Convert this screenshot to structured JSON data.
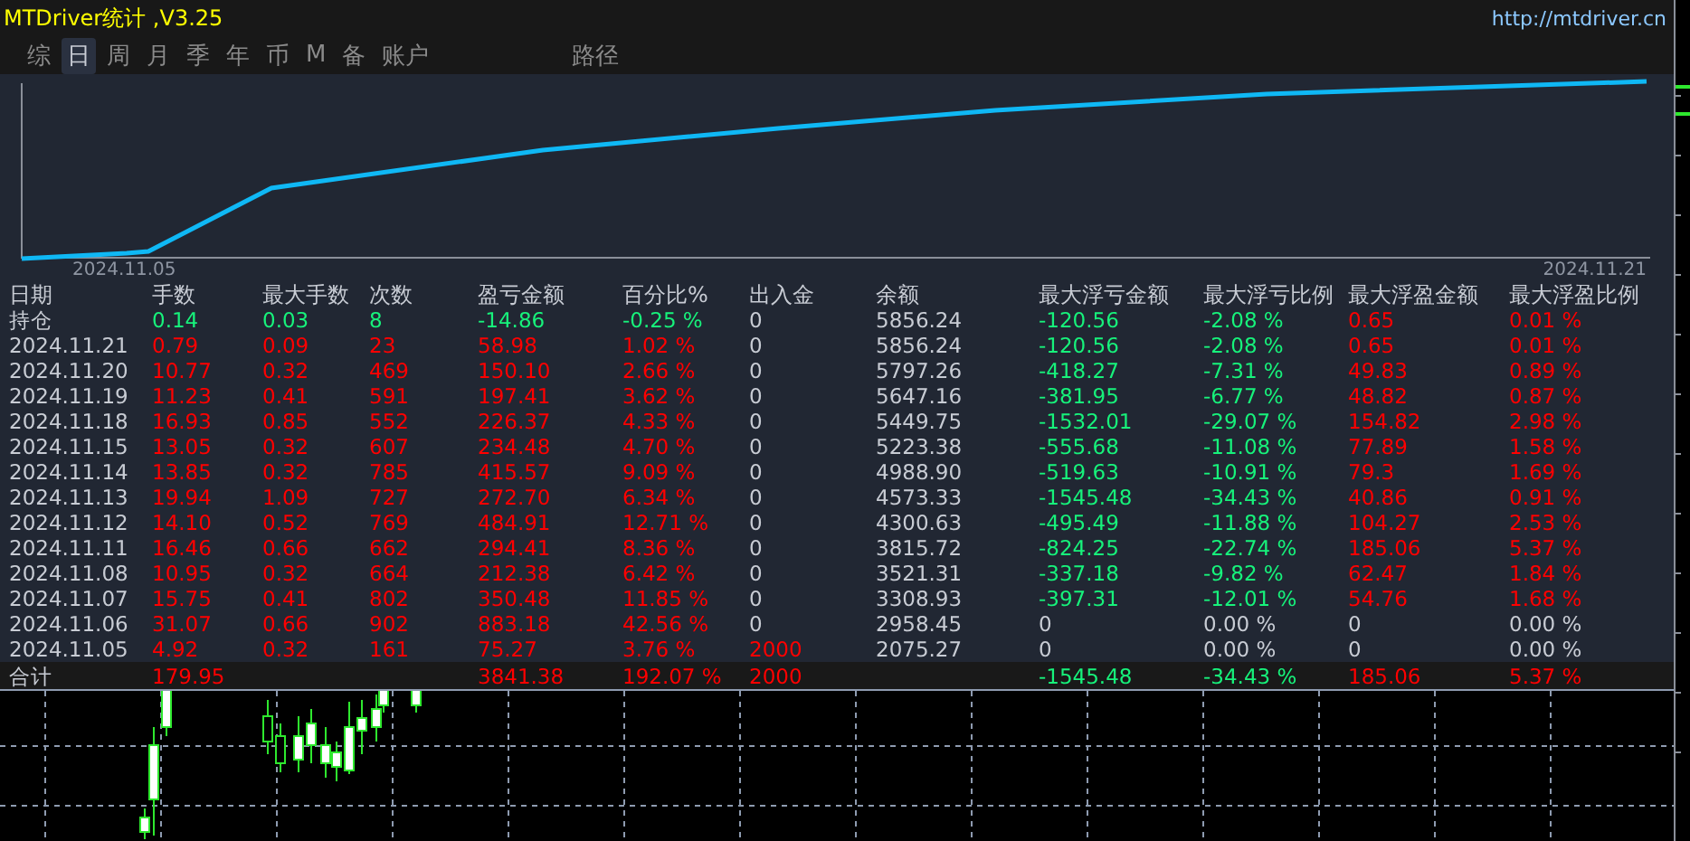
{
  "window": {
    "title": "MTDriver统计 ,V3.25",
    "link": "http://mtdriver.cn"
  },
  "tabs": [
    {
      "label": "综",
      "selected": false
    },
    {
      "label": "日",
      "selected": true
    },
    {
      "label": "周",
      "selected": false
    },
    {
      "label": "月",
      "selected": false
    },
    {
      "label": "季",
      "selected": false
    },
    {
      "label": "年",
      "selected": false
    },
    {
      "label": "币",
      "selected": false
    },
    {
      "label": "M",
      "selected": false
    },
    {
      "label": "备",
      "selected": false
    },
    {
      "label": "账户",
      "selected": false
    }
  ],
  "path_tab": {
    "label": "路径",
    "selected": false
  },
  "equity_chart": {
    "start_label": "2024.11.05",
    "end_label": "2024.11.21"
  },
  "table": {
    "columns": [
      "日期",
      "手数",
      "最大手数",
      "次数",
      "盈亏金额",
      "百分比%",
      "出入金",
      "余额",
      "最大浮亏金额",
      "最大浮亏比例",
      "最大浮盈金额",
      "最大浮盈比例"
    ],
    "rows": [
      {
        "cells": [
          {
            "text": "持仓",
            "color": "#c8ccd4"
          },
          {
            "text": "0.14",
            "color": "#17f27b"
          },
          {
            "text": "0.03",
            "color": "#17f27b"
          },
          {
            "text": "8",
            "color": "#17f27b"
          },
          {
            "text": "-14.86",
            "color": "#17f27b"
          },
          {
            "text": "-0.25 %",
            "color": "#17f27b"
          },
          {
            "text": "0",
            "color": "#c8ccd4"
          },
          {
            "text": "5856.24",
            "color": "#c8ccd4"
          },
          {
            "text": "-120.56",
            "color": "#17f27b"
          },
          {
            "text": "-2.08 %",
            "color": "#17f27b"
          },
          {
            "text": "0.65",
            "color": "#ff0000"
          },
          {
            "text": "0.01 %",
            "color": "#ff0000"
          }
        ]
      },
      {
        "cells": [
          {
            "text": "2024.11.21",
            "color": "#c8ccd4"
          },
          {
            "text": "0.79",
            "color": "#ff0000"
          },
          {
            "text": "0.09",
            "color": "#ff0000"
          },
          {
            "text": "23",
            "color": "#ff0000"
          },
          {
            "text": "58.98",
            "color": "#ff0000"
          },
          {
            "text": "1.02 %",
            "color": "#ff0000"
          },
          {
            "text": "0",
            "color": "#c8ccd4"
          },
          {
            "text": "5856.24",
            "color": "#c8ccd4"
          },
          {
            "text": "-120.56",
            "color": "#17f27b"
          },
          {
            "text": "-2.08 %",
            "color": "#17f27b"
          },
          {
            "text": "0.65",
            "color": "#ff0000"
          },
          {
            "text": "0.01 %",
            "color": "#ff0000"
          }
        ]
      },
      {
        "cells": [
          {
            "text": "2024.11.20",
            "color": "#c8ccd4"
          },
          {
            "text": "10.77",
            "color": "#ff0000"
          },
          {
            "text": "0.32",
            "color": "#ff0000"
          },
          {
            "text": "469",
            "color": "#ff0000"
          },
          {
            "text": "150.10",
            "color": "#ff0000"
          },
          {
            "text": "2.66 %",
            "color": "#ff0000"
          },
          {
            "text": "0",
            "color": "#c8ccd4"
          },
          {
            "text": "5797.26",
            "color": "#c8ccd4"
          },
          {
            "text": "-418.27",
            "color": "#17f27b"
          },
          {
            "text": "-7.31 %",
            "color": "#17f27b"
          },
          {
            "text": "49.83",
            "color": "#ff0000"
          },
          {
            "text": "0.89 %",
            "color": "#ff0000"
          }
        ]
      },
      {
        "cells": [
          {
            "text": "2024.11.19",
            "color": "#c8ccd4"
          },
          {
            "text": "11.23",
            "color": "#ff0000"
          },
          {
            "text": "0.41",
            "color": "#ff0000"
          },
          {
            "text": "591",
            "color": "#ff0000"
          },
          {
            "text": "197.41",
            "color": "#ff0000"
          },
          {
            "text": "3.62 %",
            "color": "#ff0000"
          },
          {
            "text": "0",
            "color": "#c8ccd4"
          },
          {
            "text": "5647.16",
            "color": "#c8ccd4"
          },
          {
            "text": "-381.95",
            "color": "#17f27b"
          },
          {
            "text": "-6.77 %",
            "color": "#17f27b"
          },
          {
            "text": "48.82",
            "color": "#ff0000"
          },
          {
            "text": "0.87 %",
            "color": "#ff0000"
          }
        ]
      },
      {
        "cells": [
          {
            "text": "2024.11.18",
            "color": "#c8ccd4"
          },
          {
            "text": "16.93",
            "color": "#ff0000"
          },
          {
            "text": "0.85",
            "color": "#ff0000"
          },
          {
            "text": "552",
            "color": "#ff0000"
          },
          {
            "text": "226.37",
            "color": "#ff0000"
          },
          {
            "text": "4.33 %",
            "color": "#ff0000"
          },
          {
            "text": "0",
            "color": "#c8ccd4"
          },
          {
            "text": "5449.75",
            "color": "#c8ccd4"
          },
          {
            "text": "-1532.01",
            "color": "#17f27b"
          },
          {
            "text": "-29.07 %",
            "color": "#17f27b"
          },
          {
            "text": "154.82",
            "color": "#ff0000"
          },
          {
            "text": "2.98 %",
            "color": "#ff0000"
          }
        ]
      },
      {
        "cells": [
          {
            "text": "2024.11.15",
            "color": "#c8ccd4"
          },
          {
            "text": "13.05",
            "color": "#ff0000"
          },
          {
            "text": "0.32",
            "color": "#ff0000"
          },
          {
            "text": "607",
            "color": "#ff0000"
          },
          {
            "text": "234.48",
            "color": "#ff0000"
          },
          {
            "text": "4.70 %",
            "color": "#ff0000"
          },
          {
            "text": "0",
            "color": "#c8ccd4"
          },
          {
            "text": "5223.38",
            "color": "#c8ccd4"
          },
          {
            "text": "-555.68",
            "color": "#17f27b"
          },
          {
            "text": "-11.08 %",
            "color": "#17f27b"
          },
          {
            "text": "77.89",
            "color": "#ff0000"
          },
          {
            "text": "1.58 %",
            "color": "#ff0000"
          }
        ]
      },
      {
        "cells": [
          {
            "text": "2024.11.14",
            "color": "#c8ccd4"
          },
          {
            "text": "13.85",
            "color": "#ff0000"
          },
          {
            "text": "0.32",
            "color": "#ff0000"
          },
          {
            "text": "785",
            "color": "#ff0000"
          },
          {
            "text": "415.57",
            "color": "#ff0000"
          },
          {
            "text": "9.09 %",
            "color": "#ff0000"
          },
          {
            "text": "0",
            "color": "#c8ccd4"
          },
          {
            "text": "4988.90",
            "color": "#c8ccd4"
          },
          {
            "text": "-519.63",
            "color": "#17f27b"
          },
          {
            "text": "-10.91 %",
            "color": "#17f27b"
          },
          {
            "text": "79.3",
            "color": "#ff0000"
          },
          {
            "text": "1.69 %",
            "color": "#ff0000"
          }
        ]
      },
      {
        "cells": [
          {
            "text": "2024.11.13",
            "color": "#c8ccd4"
          },
          {
            "text": "19.94",
            "color": "#ff0000"
          },
          {
            "text": "1.09",
            "color": "#ff0000"
          },
          {
            "text": "727",
            "color": "#ff0000"
          },
          {
            "text": "272.70",
            "color": "#ff0000"
          },
          {
            "text": "6.34 %",
            "color": "#ff0000"
          },
          {
            "text": "0",
            "color": "#c8ccd4"
          },
          {
            "text": "4573.33",
            "color": "#c8ccd4"
          },
          {
            "text": "-1545.48",
            "color": "#17f27b"
          },
          {
            "text": "-34.43 %",
            "color": "#17f27b"
          },
          {
            "text": "40.86",
            "color": "#ff0000"
          },
          {
            "text": "0.91 %",
            "color": "#ff0000"
          }
        ]
      },
      {
        "cells": [
          {
            "text": "2024.11.12",
            "color": "#c8ccd4"
          },
          {
            "text": "14.10",
            "color": "#ff0000"
          },
          {
            "text": "0.52",
            "color": "#ff0000"
          },
          {
            "text": "769",
            "color": "#ff0000"
          },
          {
            "text": "484.91",
            "color": "#ff0000"
          },
          {
            "text": "12.71 %",
            "color": "#ff0000"
          },
          {
            "text": "0",
            "color": "#c8ccd4"
          },
          {
            "text": "4300.63",
            "color": "#c8ccd4"
          },
          {
            "text": "-495.49",
            "color": "#17f27b"
          },
          {
            "text": "-11.88 %",
            "color": "#17f27b"
          },
          {
            "text": "104.27",
            "color": "#ff0000"
          },
          {
            "text": "2.53 %",
            "color": "#ff0000"
          }
        ]
      },
      {
        "cells": [
          {
            "text": "2024.11.11",
            "color": "#c8ccd4"
          },
          {
            "text": "16.46",
            "color": "#ff0000"
          },
          {
            "text": "0.66",
            "color": "#ff0000"
          },
          {
            "text": "662",
            "color": "#ff0000"
          },
          {
            "text": "294.41",
            "color": "#ff0000"
          },
          {
            "text": "8.36 %",
            "color": "#ff0000"
          },
          {
            "text": "0",
            "color": "#c8ccd4"
          },
          {
            "text": "3815.72",
            "color": "#c8ccd4"
          },
          {
            "text": "-824.25",
            "color": "#17f27b"
          },
          {
            "text": "-22.74 %",
            "color": "#17f27b"
          },
          {
            "text": "185.06",
            "color": "#ff0000"
          },
          {
            "text": "5.37 %",
            "color": "#ff0000"
          }
        ]
      },
      {
        "cells": [
          {
            "text": "2024.11.08",
            "color": "#c8ccd4"
          },
          {
            "text": "10.95",
            "color": "#ff0000"
          },
          {
            "text": "0.32",
            "color": "#ff0000"
          },
          {
            "text": "664",
            "color": "#ff0000"
          },
          {
            "text": "212.38",
            "color": "#ff0000"
          },
          {
            "text": "6.42 %",
            "color": "#ff0000"
          },
          {
            "text": "0",
            "color": "#c8ccd4"
          },
          {
            "text": "3521.31",
            "color": "#c8ccd4"
          },
          {
            "text": "-337.18",
            "color": "#17f27b"
          },
          {
            "text": "-9.82 %",
            "color": "#17f27b"
          },
          {
            "text": "62.47",
            "color": "#ff0000"
          },
          {
            "text": "1.84 %",
            "color": "#ff0000"
          }
        ]
      },
      {
        "cells": [
          {
            "text": "2024.11.07",
            "color": "#c8ccd4"
          },
          {
            "text": "15.75",
            "color": "#ff0000"
          },
          {
            "text": "0.41",
            "color": "#ff0000"
          },
          {
            "text": "802",
            "color": "#ff0000"
          },
          {
            "text": "350.48",
            "color": "#ff0000"
          },
          {
            "text": "11.85 %",
            "color": "#ff0000"
          },
          {
            "text": "0",
            "color": "#c8ccd4"
          },
          {
            "text": "3308.93",
            "color": "#c8ccd4"
          },
          {
            "text": "-397.31",
            "color": "#17f27b"
          },
          {
            "text": "-12.01 %",
            "color": "#17f27b"
          },
          {
            "text": "54.76",
            "color": "#ff0000"
          },
          {
            "text": "1.68 %",
            "color": "#ff0000"
          }
        ]
      },
      {
        "cells": [
          {
            "text": "2024.11.06",
            "color": "#c8ccd4"
          },
          {
            "text": "31.07",
            "color": "#ff0000"
          },
          {
            "text": "0.66",
            "color": "#ff0000"
          },
          {
            "text": "902",
            "color": "#ff0000"
          },
          {
            "text": "883.18",
            "color": "#ff0000"
          },
          {
            "text": "42.56 %",
            "color": "#ff0000"
          },
          {
            "text": "0",
            "color": "#c8ccd4"
          },
          {
            "text": "2958.45",
            "color": "#c8ccd4"
          },
          {
            "text": "0",
            "color": "#c8ccd4"
          },
          {
            "text": "0.00 %",
            "color": "#c8ccd4"
          },
          {
            "text": "0",
            "color": "#c8ccd4"
          },
          {
            "text": "0.00 %",
            "color": "#c8ccd4"
          }
        ]
      },
      {
        "cells": [
          {
            "text": "2024.11.05",
            "color": "#c8ccd4"
          },
          {
            "text": "4.92",
            "color": "#ff0000"
          },
          {
            "text": "0.32",
            "color": "#ff0000"
          },
          {
            "text": "161",
            "color": "#ff0000"
          },
          {
            "text": "75.27",
            "color": "#ff0000"
          },
          {
            "text": "3.76 %",
            "color": "#ff0000"
          },
          {
            "text": "2000",
            "color": "#ff0000"
          },
          {
            "text": "2075.27",
            "color": "#c8ccd4"
          },
          {
            "text": "0",
            "color": "#c8ccd4"
          },
          {
            "text": "0.00 %",
            "color": "#c8ccd4"
          },
          {
            "text": "0",
            "color": "#c8ccd4"
          },
          {
            "text": "0.00 %",
            "color": "#c8ccd4"
          }
        ]
      }
    ],
    "total": {
      "label": {
        "text": "合计",
        "color": "#c8ccd4"
      },
      "lots": {
        "text": "179.95",
        "color": "#ff0000"
      },
      "profit": {
        "text": "3841.38",
        "color": "#ff0000"
      },
      "percent": {
        "text": "192.07 %",
        "color": "#ff0000"
      },
      "deposit": {
        "text": "2000",
        "color": "#ff0000"
      },
      "max_float_loss": {
        "text": "-1545.48",
        "color": "#17f27b"
      },
      "max_float_loss_pct": {
        "text": "-34.43 %",
        "color": "#17f27b"
      },
      "max_float_profit": {
        "text": "185.06",
        "color": "#ff0000"
      },
      "max_float_profit_pct": {
        "text": "5.37 %",
        "color": "#ff0000"
      }
    }
  }
}
